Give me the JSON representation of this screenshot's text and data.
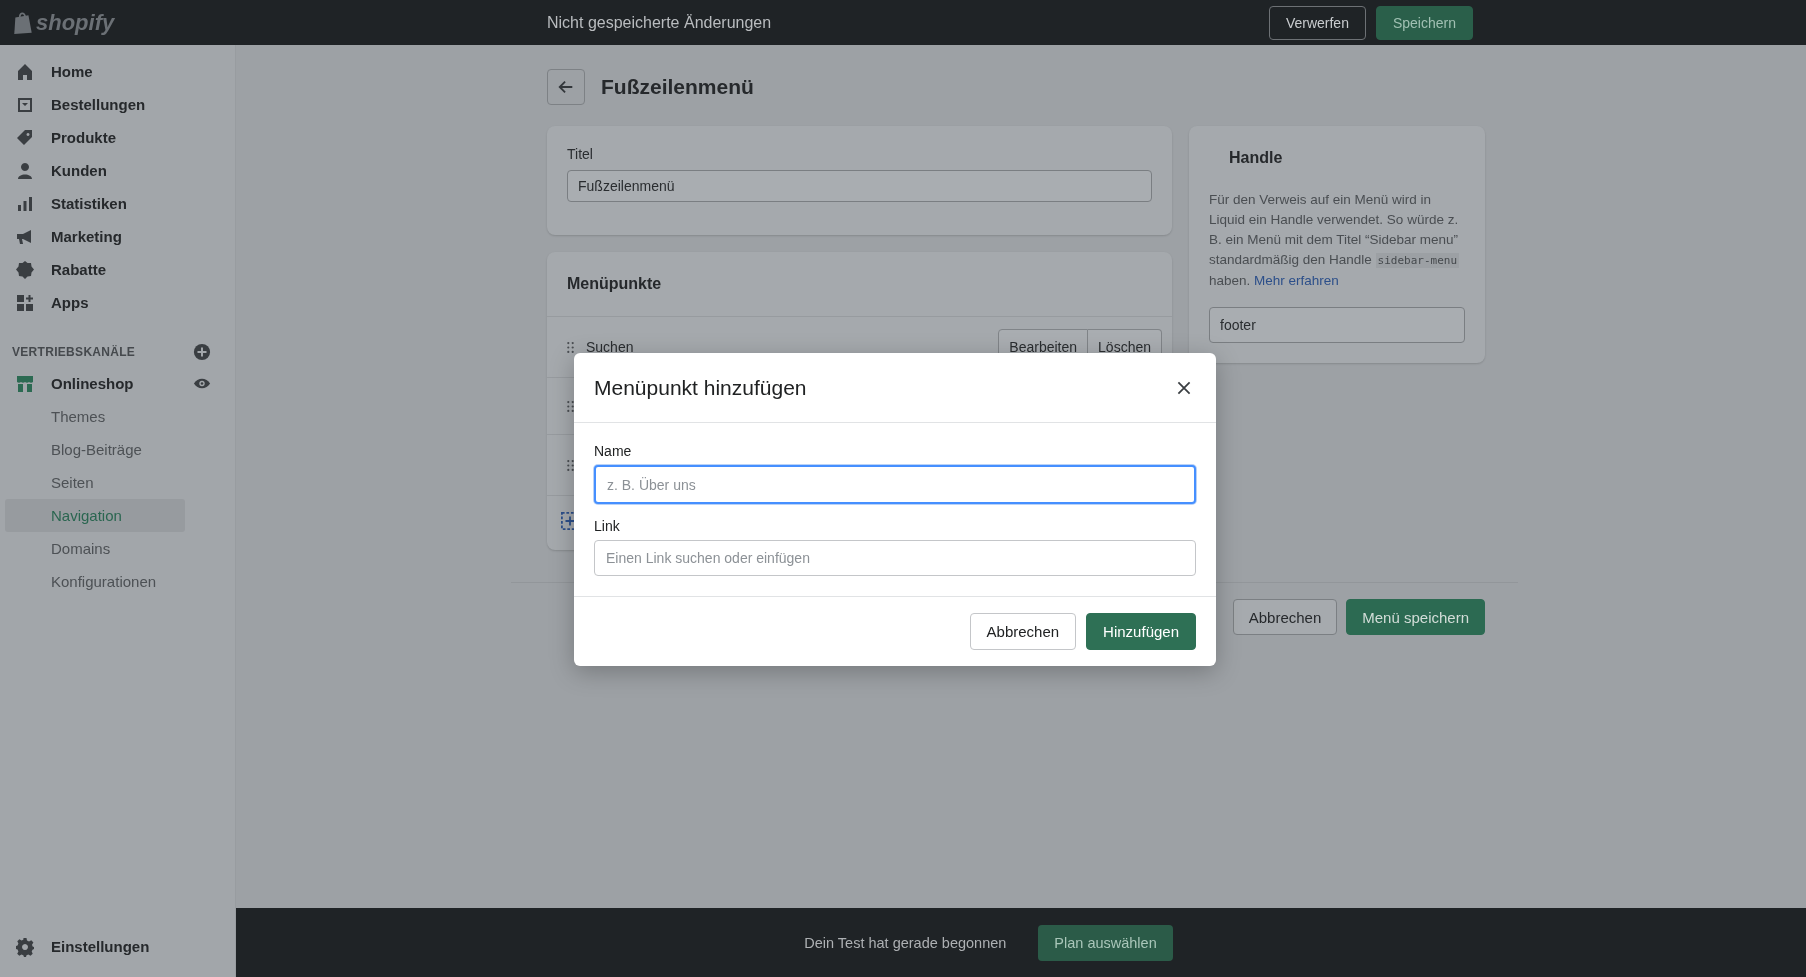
{
  "topbar": {
    "logo": "shopify",
    "message": "Nicht gespeicherte Änderungen",
    "buttons": [
      {
        "label": "Verwerfen",
        "kind": "secondary"
      },
      {
        "label": "Speichern",
        "kind": "primary"
      }
    ]
  },
  "sidebar": {
    "items": [
      {
        "label": "Home"
      },
      {
        "label": "Bestellungen"
      },
      {
        "label": "Produkte"
      },
      {
        "label": "Kunden"
      },
      {
        "label": "Statistiken"
      },
      {
        "label": "Marketing"
      },
      {
        "label": "Rabatte"
      },
      {
        "label": "Apps"
      }
    ],
    "channels_heading": "VERTRIEBSKANÄLE",
    "channel": {
      "label": "Onlineshop",
      "children": [
        {
          "label": "Themes",
          "selected": false
        },
        {
          "label": "Blog-Beiträge",
          "selected": false
        },
        {
          "label": "Seiten",
          "selected": false
        },
        {
          "label": "Navigation",
          "selected": true
        },
        {
          "label": "Domains",
          "selected": false
        },
        {
          "label": "Konfigurationen",
          "selected": false
        }
      ]
    },
    "settings": "Einstellungen"
  },
  "page": {
    "title": "Fußzeilenmenü",
    "title_card": {
      "label": "Titel",
      "value": "Fußzeilenmenü"
    },
    "menu_card": {
      "heading": "Menüpunkte",
      "items": [
        {
          "label": "Suchen",
          "actions": [
            "Bearbeiten",
            "Löschen"
          ]
        }
      ]
    },
    "handle_card": {
      "heading": "Handle",
      "text_before": "Für den Verweis auf ein Menü wird in Liquid ein Handle verwendet. So würde z. B. ein Menü mit dem Titel “Sidebar menu” standardmäßig den Handle",
      "code": "sidebar-menu",
      "text_after": "haben.",
      "link": "Mehr erfahren",
      "value": "footer"
    },
    "actions": [
      {
        "label": "Abbrechen",
        "kind": "secondary"
      },
      {
        "label": "Menü speichern",
        "kind": "primary"
      }
    ]
  },
  "modal": {
    "title": "Menüpunkt hinzufügen",
    "fields": [
      {
        "label": "Name",
        "placeholder": "z. B. Über uns",
        "focused": true
      },
      {
        "label": "Link",
        "placeholder": "Einen Link suchen oder einfügen",
        "focused": false
      }
    ],
    "buttons": [
      {
        "label": "Abbrechen",
        "kind": "secondary"
      },
      {
        "label": "Hinzufügen",
        "kind": "primary"
      }
    ]
  },
  "trial_bar": {
    "message": "Dein Test hat gerade begonnen",
    "button": "Plan auswählen"
  }
}
